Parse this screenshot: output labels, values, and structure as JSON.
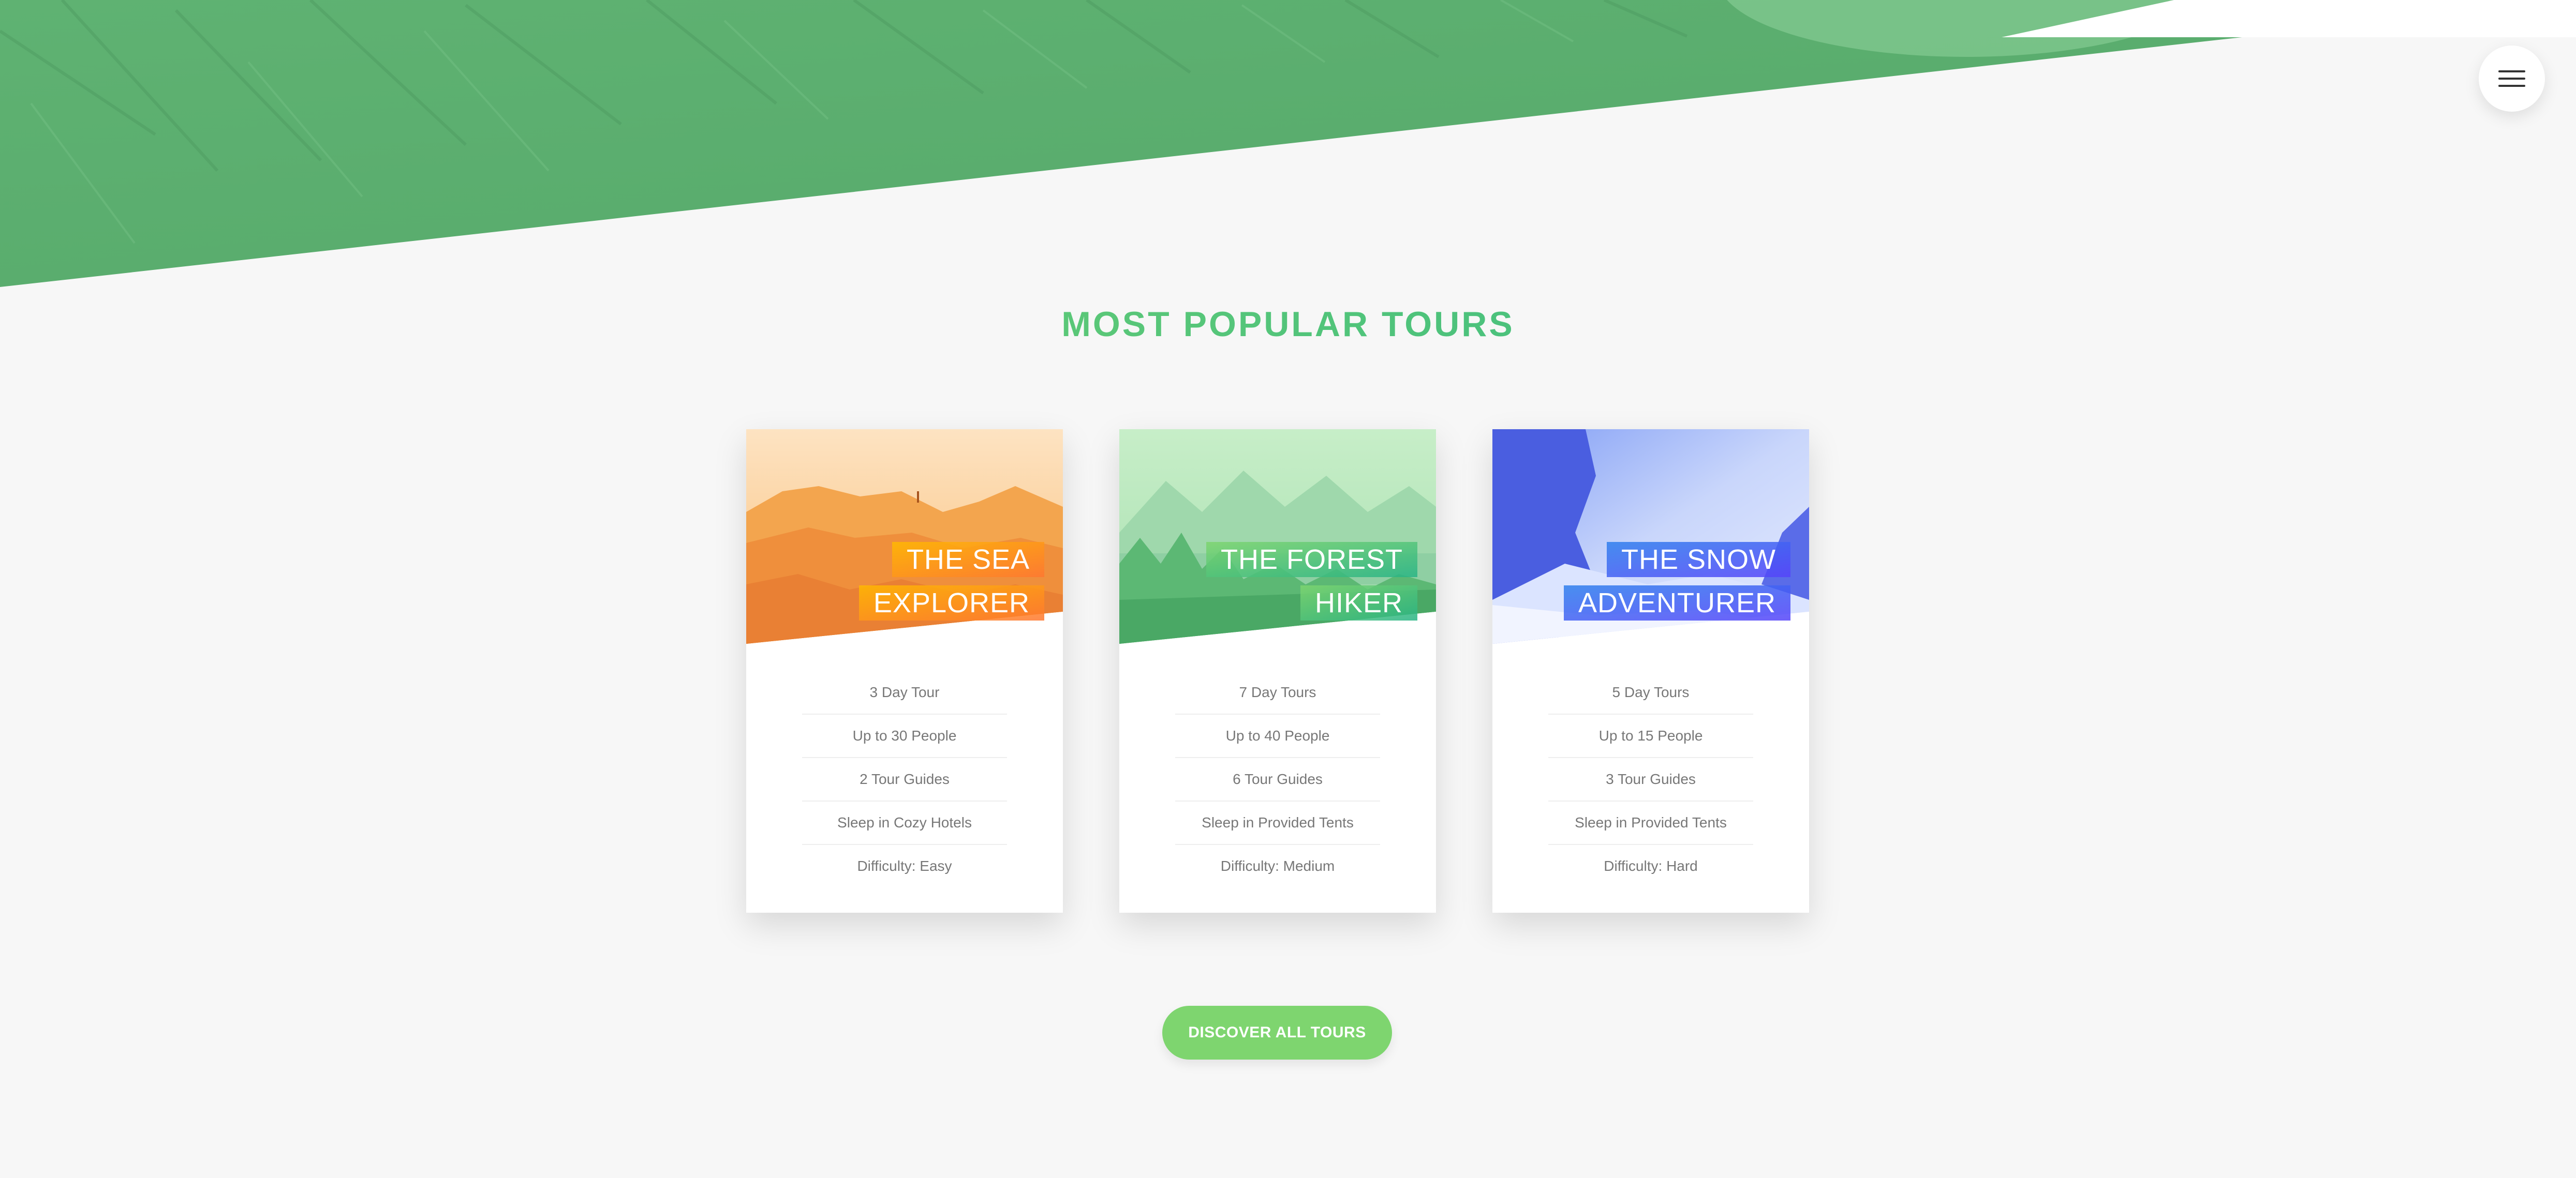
{
  "colors": {
    "primary": "#7ed56f",
    "primary_dark": "#28b485",
    "orange_light": "#ffb900",
    "orange_dark": "#ff7730",
    "blue_light": "#2f80ed",
    "blue_dark": "#5643fa",
    "background": "#f7f7f7"
  },
  "nav": {
    "icon": "hamburger-menu-icon"
  },
  "section": {
    "title": "MOST POPULAR TOURS"
  },
  "cards": [
    {
      "heading_line1": "THE SEA",
      "heading_line2": "EXPLORER",
      "details": [
        "3 Day Tour",
        "Up to 30 People",
        "2 Tour Guides",
        "Sleep in Cozy Hotels",
        "Difficulty: Easy"
      ]
    },
    {
      "heading_line1": "THE FOREST",
      "heading_line2": "HIKER",
      "details": [
        "7 Day Tours",
        "Up to 40 People",
        "6 Tour Guides",
        "Sleep in Provided Tents",
        "Difficulty: Medium"
      ]
    },
    {
      "heading_line1": "THE SNOW",
      "heading_line2": "ADVENTURER",
      "details": [
        "5 Day Tours",
        "Up to 15 People",
        "3 Tour Guides",
        "Sleep in Provided Tents",
        "Difficulty: Hard"
      ]
    }
  ],
  "cta": {
    "label": "DISCOVER ALL TOURS"
  }
}
